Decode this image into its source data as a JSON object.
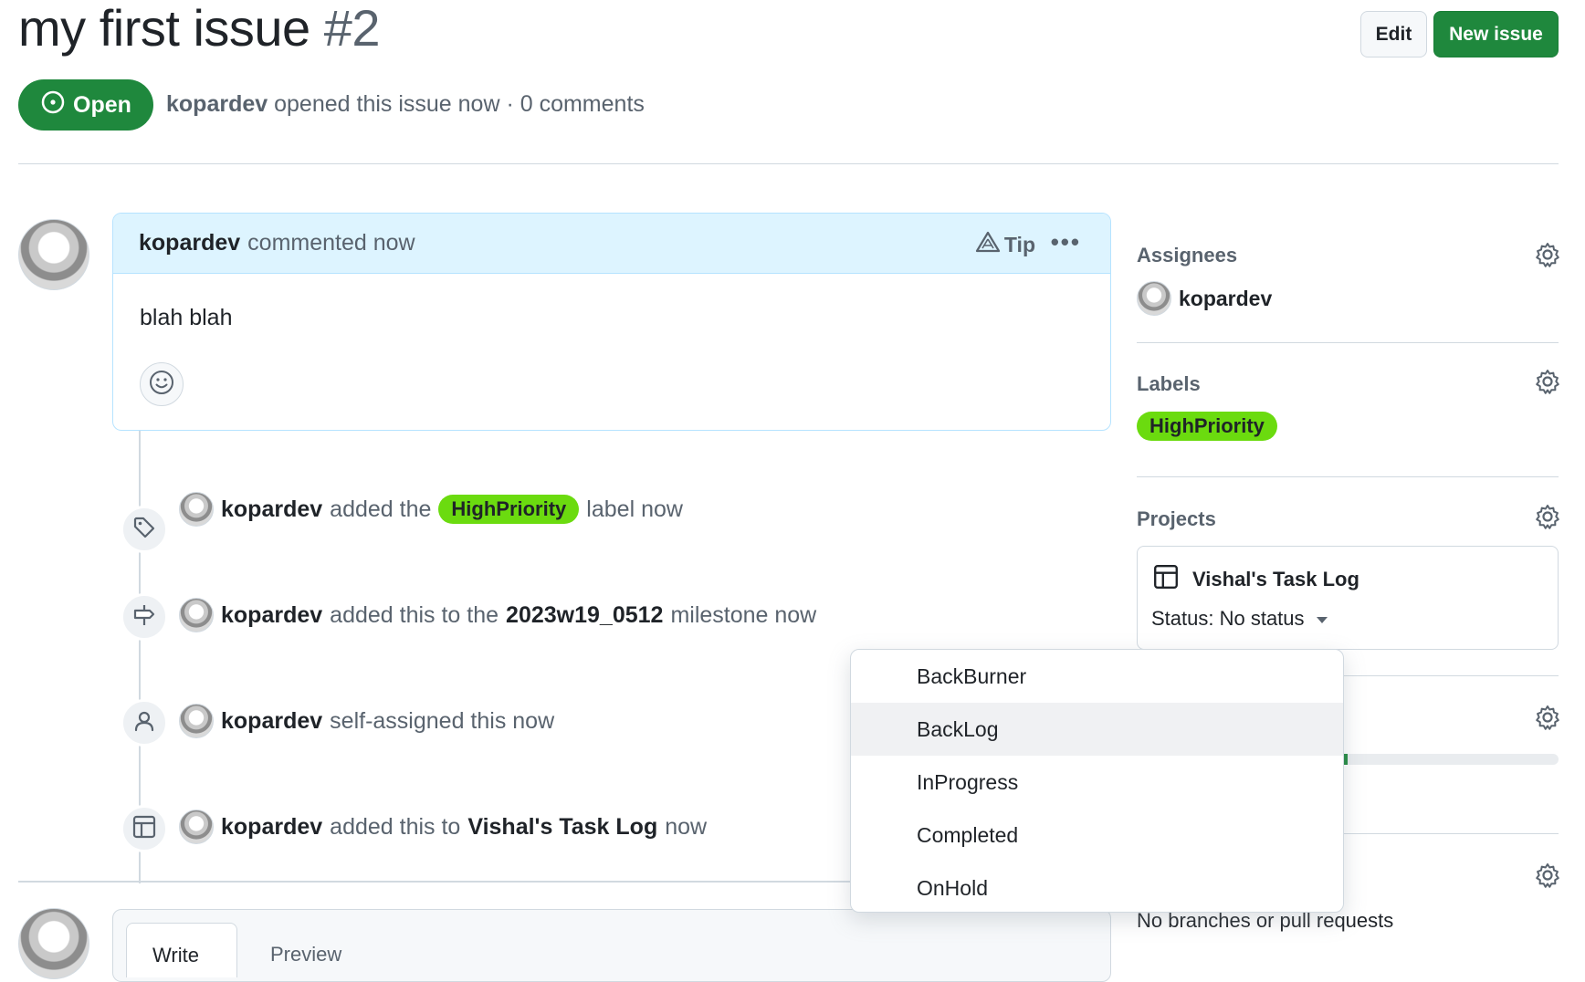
{
  "header": {
    "title": "my first issue",
    "number": "#2",
    "edit_label": "Edit",
    "new_issue_label": "New issue"
  },
  "status": {
    "state_label": "Open",
    "author": "kopardev",
    "meta": "opened this issue now · 0 comments"
  },
  "comment": {
    "author": "kopardev",
    "action": "commented now",
    "tip_label": "Tip",
    "body": "blah blah"
  },
  "timeline": [
    {
      "icon": "tag-icon",
      "author": "kopardev",
      "pre": "added the",
      "label": "HighPriority",
      "post": "label now"
    },
    {
      "icon": "milestone-icon",
      "author": "kopardev",
      "pre": "added this to the",
      "bold": "2023w19_0512",
      "post": "milestone now"
    },
    {
      "icon": "person-icon",
      "author": "kopardev",
      "pre": "self-assigned this now"
    },
    {
      "icon": "table-icon",
      "author": "kopardev",
      "pre": "added this to",
      "bold": "Vishal's Task Log",
      "post": "now"
    }
  ],
  "sidebar": {
    "assignees_title": "Assignees",
    "assignee": "kopardev",
    "labels_title": "Labels",
    "label": "HighPriority",
    "projects_title": "Projects",
    "project_name": "Vishal's Task Log",
    "project_status": "Status: No status",
    "development_empty": "No branches or pull requests"
  },
  "dropdown": {
    "options": [
      "BackBurner",
      "BackLog",
      "InProgress",
      "Completed",
      "OnHold"
    ],
    "hovered": "BackLog"
  },
  "compose": {
    "write_tab": "Write",
    "preview_tab": "Preview"
  },
  "colors": {
    "open_green": "#1f883d",
    "label_green": "#6bdb0f",
    "comment_header": "#ddf4ff"
  }
}
